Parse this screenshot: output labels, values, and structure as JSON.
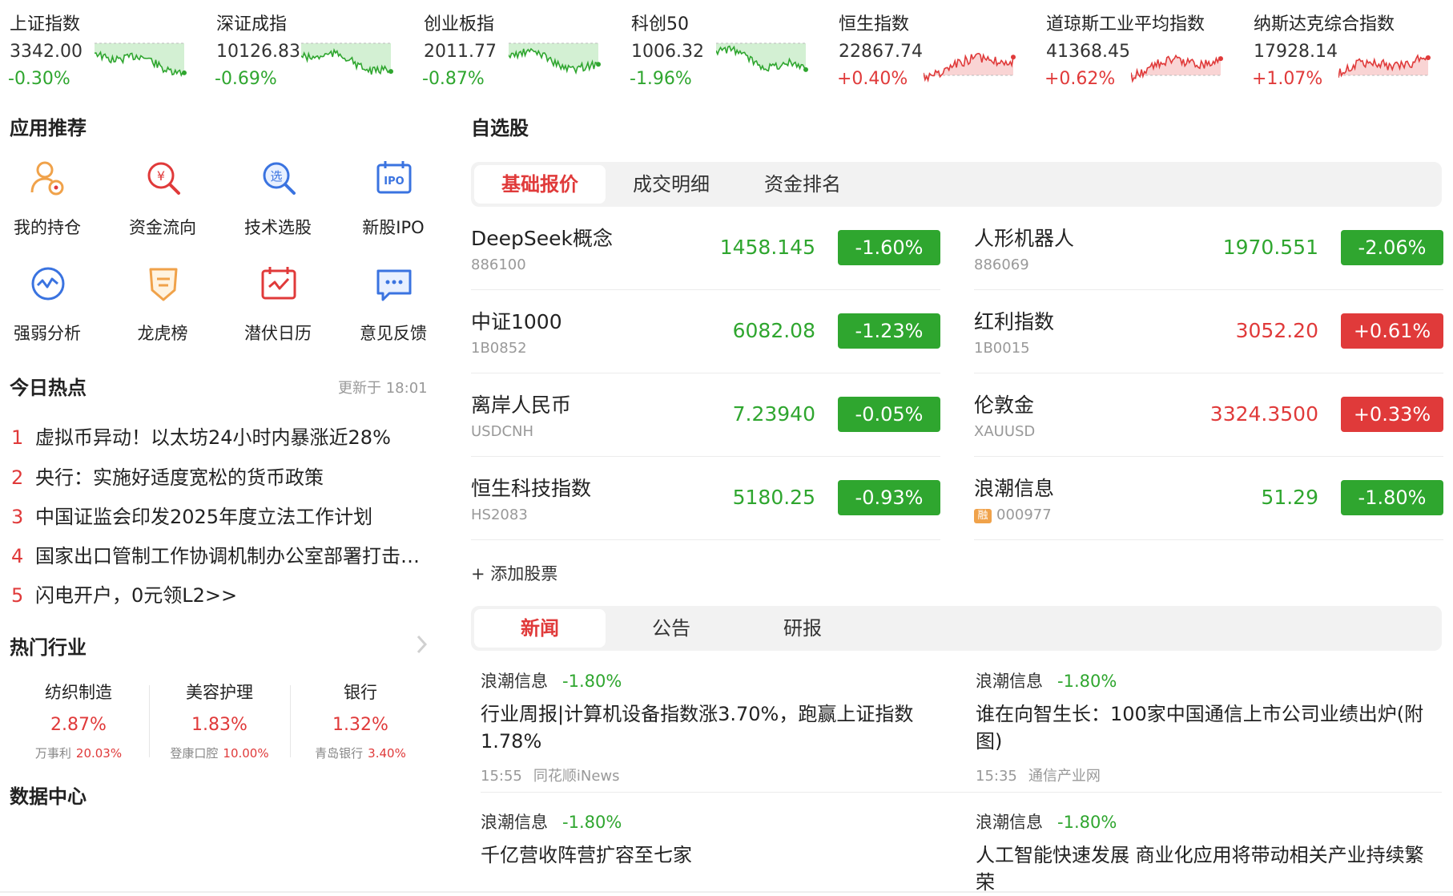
{
  "indices": [
    {
      "name": "上证指数",
      "value": "3342.00",
      "change": "-0.30%",
      "trend": "down"
    },
    {
      "name": "深证成指",
      "value": "10126.83",
      "change": "-0.69%",
      "trend": "down"
    },
    {
      "name": "创业板指",
      "value": "2011.77",
      "change": "-0.87%",
      "trend": "down"
    },
    {
      "name": "科创50",
      "value": "1006.32",
      "change": "-1.96%",
      "trend": "down"
    },
    {
      "name": "恒生指数",
      "value": "22867.74",
      "change": "+0.40%",
      "trend": "up"
    },
    {
      "name": "道琼斯工业平均指数",
      "value": "41368.45",
      "change": "+0.62%",
      "trend": "up"
    },
    {
      "name": "纳斯达克综合指数",
      "value": "17928.14",
      "change": "+1.07%",
      "trend": "up"
    }
  ],
  "apps": {
    "title": "应用推荐",
    "items": [
      {
        "label": "我的持仓",
        "icon": "holdings-icon"
      },
      {
        "label": "资金流向",
        "icon": "money-flow-icon"
      },
      {
        "label": "技术选股",
        "icon": "stock-picker-icon"
      },
      {
        "label": "新股IPO",
        "icon": "ipo-calendar-icon"
      },
      {
        "label": "强弱分析",
        "icon": "strength-analysis-icon"
      },
      {
        "label": "龙虎榜",
        "icon": "dragon-tiger-icon"
      },
      {
        "label": "潜伏日历",
        "icon": "calendar-icon"
      },
      {
        "label": "意见反馈",
        "icon": "feedback-icon"
      }
    ]
  },
  "hot": {
    "title": "今日热点",
    "updated": "更新于 18:01",
    "items": [
      {
        "num": "1",
        "text": "虚拟币异动！以太坊24小时内暴涨近28%"
      },
      {
        "num": "2",
        "text": "央行：实施好适度宽松的货币政策"
      },
      {
        "num": "3",
        "text": "中国证监会印发2025年度立法工作计划"
      },
      {
        "num": "4",
        "text": "国家出口管制工作协调机制办公室部署打击战略矿产走私出口专项行动"
      },
      {
        "num": "5",
        "text": "闪电开户，0元领L2>>"
      }
    ]
  },
  "industries": {
    "title": "热门行业",
    "items": [
      {
        "name": "纺织制造",
        "pct": "2.87%",
        "leader": "万事利",
        "leader_pct": "20.03%"
      },
      {
        "name": "美容护理",
        "pct": "1.83%",
        "leader": "登康口腔",
        "leader_pct": "10.00%"
      },
      {
        "name": "银行",
        "pct": "1.32%",
        "leader": "青岛银行",
        "leader_pct": "3.40%"
      }
    ]
  },
  "data_center": {
    "title": "数据中心"
  },
  "watchlist": {
    "title": "自选股",
    "tabs": [
      "基础报价",
      "成交明细",
      "资金排名"
    ],
    "add_label": "+ 添加股票",
    "items": [
      {
        "name": "DeepSeek概念",
        "code": "886100",
        "price": "1458.145",
        "change": "-1.60%",
        "trend": "down",
        "badge": ""
      },
      {
        "name": "人形机器人",
        "code": "886069",
        "price": "1970.551",
        "change": "-2.06%",
        "trend": "down",
        "badge": ""
      },
      {
        "name": "中证1000",
        "code": "1B0852",
        "price": "6082.08",
        "change": "-1.23%",
        "trend": "down",
        "badge": ""
      },
      {
        "name": "红利指数",
        "code": "1B0015",
        "price": "3052.20",
        "change": "+0.61%",
        "trend": "up",
        "badge": ""
      },
      {
        "name": "离岸人民币",
        "code": "USDCNH",
        "price": "7.23940",
        "change": "-0.05%",
        "trend": "down",
        "badge": ""
      },
      {
        "name": "伦敦金",
        "code": "XAUUSD",
        "price": "3324.3500",
        "change": "+0.33%",
        "trend": "up",
        "badge": ""
      },
      {
        "name": "恒生科技指数",
        "code": "HS2083",
        "price": "5180.25",
        "change": "-0.93%",
        "trend": "down",
        "badge": ""
      },
      {
        "name": "浪潮信息",
        "code": "000977",
        "price": "51.29",
        "change": "-1.80%",
        "trend": "down",
        "badge": "融"
      }
    ]
  },
  "news": {
    "tabs": [
      "新闻",
      "公告",
      "研报"
    ],
    "items": [
      {
        "stock": "浪潮信息",
        "change": "-1.80%",
        "title": "行业周报|计算机设备指数涨3.70%，跑赢上证指数1.78%",
        "time": "15:55",
        "source": "同花顺iNews"
      },
      {
        "stock": "浪潮信息",
        "change": "-1.80%",
        "title": "谁在向智生长：100家中国通信上市公司业绩出炉(附图)",
        "time": "15:35",
        "source": "通信产业网"
      },
      {
        "stock": "浪潮信息",
        "change": "-1.80%",
        "title": "千亿营收阵营扩容至七家",
        "time": "",
        "source": ""
      },
      {
        "stock": "浪潮信息",
        "change": "-1.80%",
        "title": "人工智能快速发展 商业化应用将带动相关产业持续繁荣",
        "time": "",
        "source": ""
      }
    ]
  },
  "colors": {
    "up": "#e03a3a",
    "down": "#2fa62f",
    "accent": "#e03a3a"
  }
}
